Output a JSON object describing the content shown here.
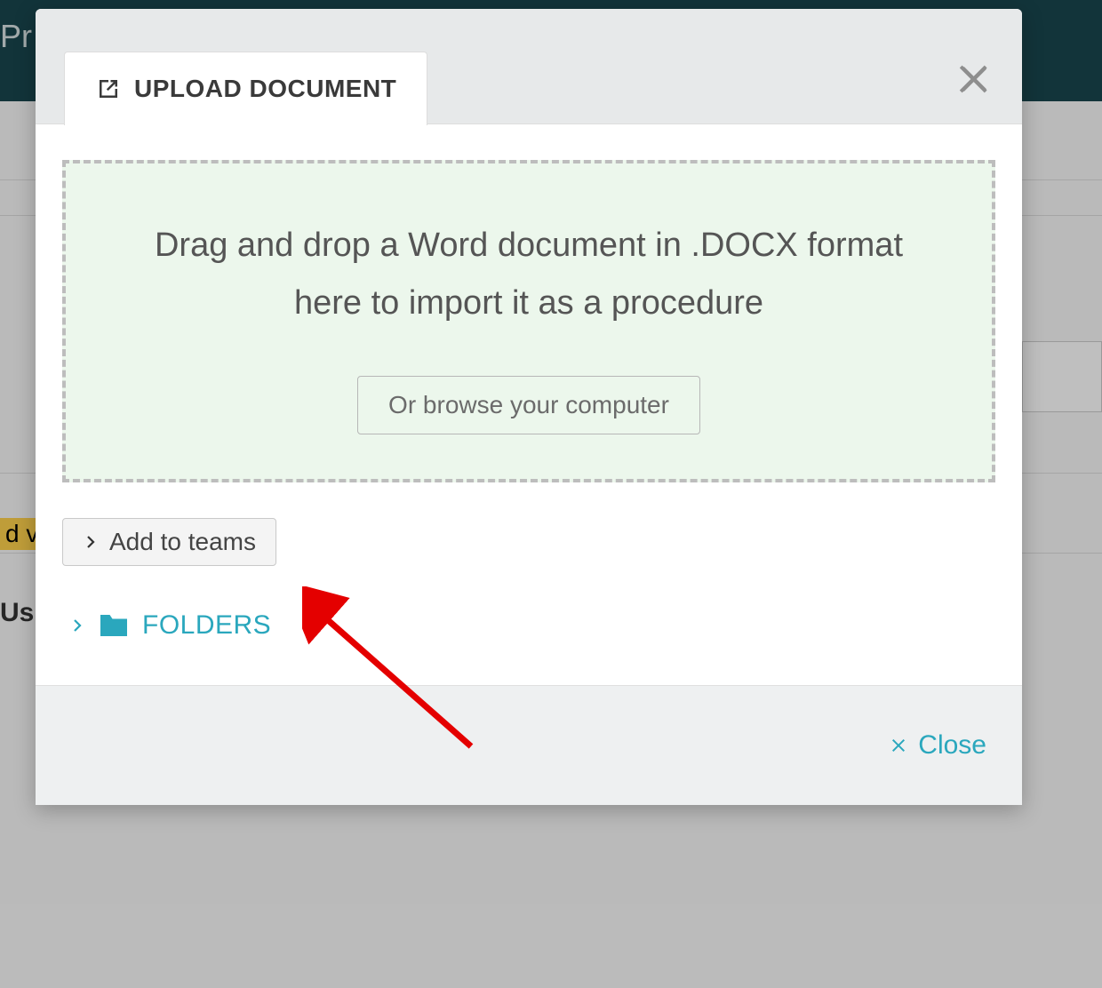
{
  "background": {
    "title_fragment": "Pr",
    "badge_fragment": "d v",
    "row_fragment": "Us"
  },
  "modal": {
    "tab_label": "UPLOAD DOCUMENT",
    "dropzone_text": "Drag and drop a Word document in .DOCX format here to import it as a procedure",
    "browse_label": "Or browse your computer",
    "teams_label": "Add to teams",
    "folders_label": "FOLDERS",
    "close_label": "Close"
  }
}
